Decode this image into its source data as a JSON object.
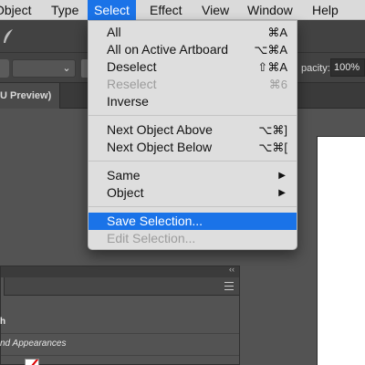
{
  "menubar": {
    "items": [
      "Object",
      "Type",
      "Select",
      "Effect",
      "View",
      "Window",
      "Help"
    ],
    "active": "Select"
  },
  "control_bar": {
    "opacity_label": "pacity:",
    "opacity_value": "100%"
  },
  "document_tab": {
    "label": "U Preview)"
  },
  "select_menu": {
    "items": [
      {
        "label": "All",
        "shortcut": "⌘A",
        "enabled": true
      },
      {
        "label": "All on Active Artboard",
        "shortcut": "⌥⌘A",
        "enabled": true
      },
      {
        "label": "Deselect",
        "shortcut": "⇧⌘A",
        "enabled": true
      },
      {
        "label": "Reselect",
        "shortcut": "⌘6",
        "enabled": false
      },
      {
        "label": "Inverse",
        "shortcut": "",
        "enabled": true
      },
      {
        "label": "Next Object Above",
        "shortcut": "⌥⌘]",
        "enabled": true
      },
      {
        "label": "Next Object Below",
        "shortcut": "⌥⌘[",
        "enabled": true
      },
      {
        "label": "Same",
        "shortcut": "",
        "submenu": true,
        "enabled": true
      },
      {
        "label": "Object",
        "shortcut": "",
        "submenu": true,
        "enabled": true
      },
      {
        "label": "Save Selection...",
        "shortcut": "",
        "enabled": true,
        "highlighted": true
      },
      {
        "label": "Edit Selection...",
        "shortcut": "",
        "enabled": false
      }
    ],
    "submenu_arrow": "▶"
  },
  "panel": {
    "collapse_glyph": "‹‹",
    "rows": [
      {
        "label": "h"
      },
      {
        "label": "nd Appearances"
      },
      {
        "label": ""
      }
    ]
  },
  "colors": {
    "accent": "#1a73e8",
    "menubar": "#dadada",
    "app_bg": "#535353"
  }
}
